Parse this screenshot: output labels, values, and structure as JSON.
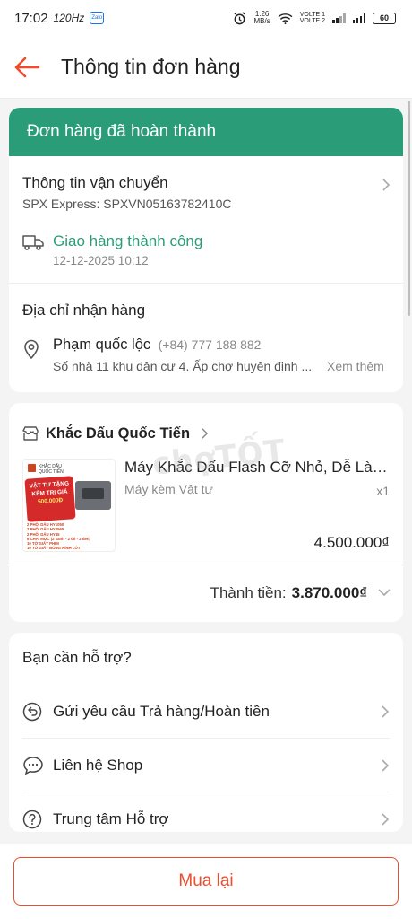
{
  "status_bar": {
    "time": "17:02",
    "refresh": "120Hz",
    "zalo": "Zalo",
    "speed_value": "1.26",
    "speed_unit": "MB/s",
    "volte1": "VOLTE 1",
    "volte2": "VOLTE 2",
    "battery": "60"
  },
  "header": {
    "title": "Thông tin đơn hàng",
    "back_icon": "arrow-left-icon"
  },
  "order_status": {
    "banner": "Đơn hàng đã hoàn thành",
    "color": "#2a9d78"
  },
  "shipping": {
    "title": "Thông tin vận chuyển",
    "carrier": "SPX Express: SPXVN05163782410C",
    "status": "Giao hàng thành công",
    "time": "12-12-2025 10:12"
  },
  "address": {
    "title": "Địa chỉ nhận hàng",
    "name": "Phạm quốc lộc",
    "phone": "(+84) 777 188 882",
    "detail": "Số nhà 11 khu dân cư 4. Ấp chợ huyện định ...",
    "more": "Xem thêm"
  },
  "shop": {
    "name": "Khắc Dấu Quốc Tiến",
    "product": {
      "name": "Máy Khắc Dấu Flash Cỡ Nhỏ, Dễ Làm...",
      "variant": "Máy kèm Vật tư",
      "qty": "x1",
      "price": "4.500.000₫",
      "thumb_brand": "KHẮC DẤU QUỐC TIẾN",
      "thumb_promo_line1": "VẬT TƯ TẶNG",
      "thumb_promo_line2": "KÈM TRỊ GIÁ",
      "thumb_promo_line3": "500.000Đ",
      "thumb_items": [
        "2 PHÔI DẤU HY1050",
        "2 PHÔI DẤU HY2565",
        "2 PHÔI DẤU HY45",
        "6 CHAI MỰC (2 xanh - 2 đỏ - 2 đen)",
        "10 TỜ GIẤY PHIM",
        "10 TỜ GIẤY BÓNG KÍNH LÓT"
      ]
    },
    "total_label": "Thành tiền:",
    "total_value": "3.870.000₫"
  },
  "support": {
    "title": "Bạn cần hỗ trợ?",
    "items": [
      {
        "label": "Gửi yêu cầu Trả hàng/Hoàn tiền",
        "icon": "return-icon"
      },
      {
        "label": "Liên hệ Shop",
        "icon": "chat-icon"
      },
      {
        "label": "Trung tâm Hỗ trợ",
        "icon": "help-icon"
      }
    ]
  },
  "footer": {
    "buy_again": "Mua lại",
    "accent": "#ee4d2d"
  },
  "watermark": "chợTỐT"
}
